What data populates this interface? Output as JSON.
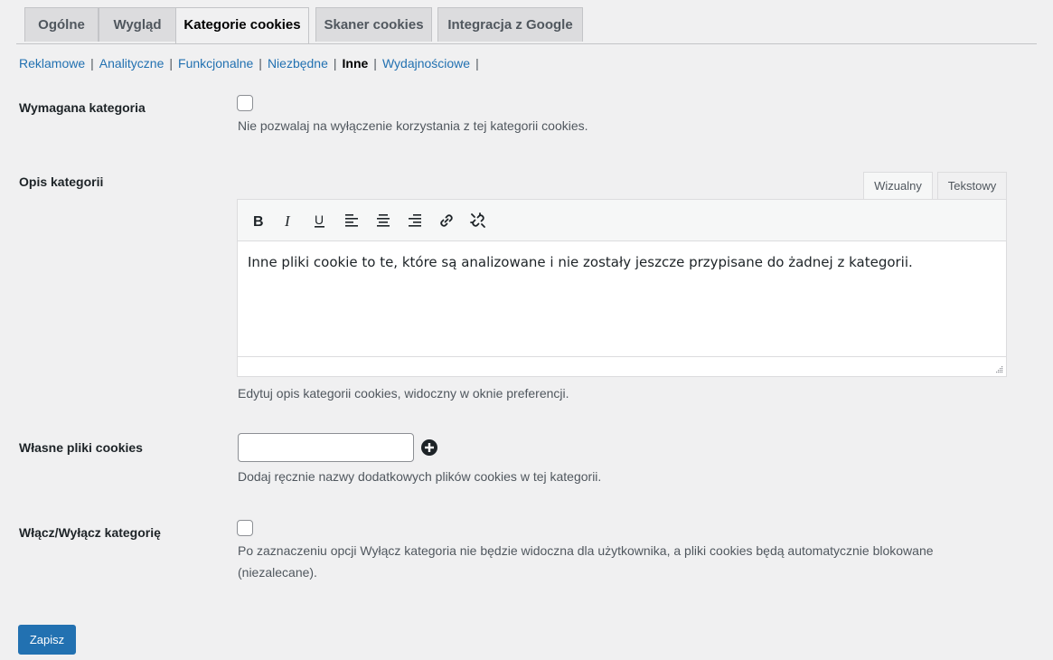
{
  "tabs": [
    {
      "label": "Ogólne"
    },
    {
      "label": "Wygląd"
    },
    {
      "label": "Kategorie cookies",
      "active": true
    },
    {
      "label": "Skaner cookies"
    },
    {
      "label": "Integracja z Google"
    }
  ],
  "subnav": {
    "items": [
      "Reklamowe",
      "Analityczne",
      "Funkcjonalne",
      "Niezbędne",
      "Inne",
      "Wydajnościowe"
    ],
    "current": "Inne",
    "separator": "|"
  },
  "required": {
    "label": "Wymagana kategoria",
    "checked": false,
    "description": "Nie pozwalaj na wyłączenie korzystania z tej kategorii cookies."
  },
  "description_field": {
    "label": "Opis kategorii",
    "tab_visual": "Wizualny",
    "tab_text": "Tekstowy",
    "toolbar_icons": [
      "bold-icon",
      "italic-icon",
      "underline-icon",
      "align-left-icon",
      "align-center-icon",
      "align-right-icon",
      "link-icon",
      "unlink-icon"
    ],
    "content": "Inne pliki cookie to te, które są analizowane i nie zostały jeszcze przypisane do żadnej z kategorii.",
    "help": "Edytuj opis kategorii cookies, widoczny w oknie preferencji."
  },
  "custom_cookies": {
    "label": "Własne pliki cookies",
    "value": "",
    "add_icon": "plus-circle-icon",
    "description": "Dodaj ręcznie nazwy dodatkowych plików cookies w tej kategorii."
  },
  "toggle": {
    "label": "Włącz/Wyłącz kategorię",
    "checked": false,
    "description_line1": "Po zaznaczeniu opcji Wyłącz kategoria nie będzie widoczna dla użytkownika, a pliki cookies będą automatycznie blokowane",
    "description_line2": "(niezalecane)."
  },
  "save_label": "Zapisz",
  "colors": {
    "link": "#2271b1",
    "button": "#2271b1",
    "background": "#f0f0f1"
  }
}
